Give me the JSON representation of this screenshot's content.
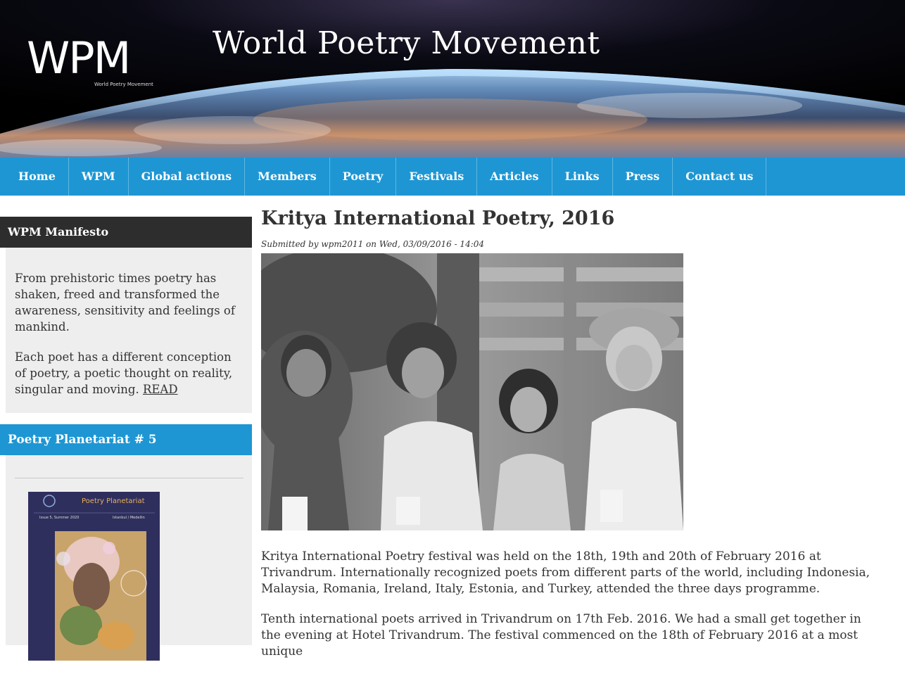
{
  "header": {
    "logo_text": "WPM",
    "logo_subtext": "World Poetry Movement",
    "site_title": "World Poetry Movement"
  },
  "nav": {
    "items": [
      {
        "label": "Home"
      },
      {
        "label": "WPM"
      },
      {
        "label": "Global actions"
      },
      {
        "label": "Members"
      },
      {
        "label": "Poetry"
      },
      {
        "label": "Festivals"
      },
      {
        "label": "Articles"
      },
      {
        "label": "Links"
      },
      {
        "label": "Press"
      },
      {
        "label": "Contact us"
      }
    ]
  },
  "sidebar": {
    "manifesto": {
      "title": "WPM Manifesto",
      "paragraph1": "From prehistoric times poetry has shaken, freed and transformed the awareness, sensitivity and feelings of mankind.",
      "paragraph2": "Each poet has a different conception of poetry, a poetic thought on reality, singular and moving.",
      "read_link": "READ"
    },
    "planetariat": {
      "title": "Poetry Planetariat # 5",
      "cover_title": "Poetry Planetariat",
      "cover_issue": "Issue 5, Summer 2020",
      "cover_cities": "Istanbul / Medellin"
    }
  },
  "article": {
    "title": "Kritya International Poetry, 2016",
    "submitted": "Submitted by wpm2011 on Wed, 03/09/2016 - 14:04",
    "paragraph1": "Kritya International Poetry festival was held on the 18th, 19th and 20th of February 2016 at Trivandrum. Internationally recognized poets from different parts of the world, including Indonesia, Malaysia, Romania, Ireland, Italy, Estonia, and Turkey, attended the three days programme.",
    "paragraph2": "Tenth international poets arrived in Trivandrum on 17th Feb. 2016. We had a small get together in the evening at Hotel Trivandrum. The festival commenced on the 18th of February 2016 at a most unique"
  },
  "colors": {
    "nav_bg": "#1e96d3",
    "sidebar_dark": "#2d2d2d",
    "sidebar_bg": "#eeeeee",
    "text": "#333333"
  }
}
